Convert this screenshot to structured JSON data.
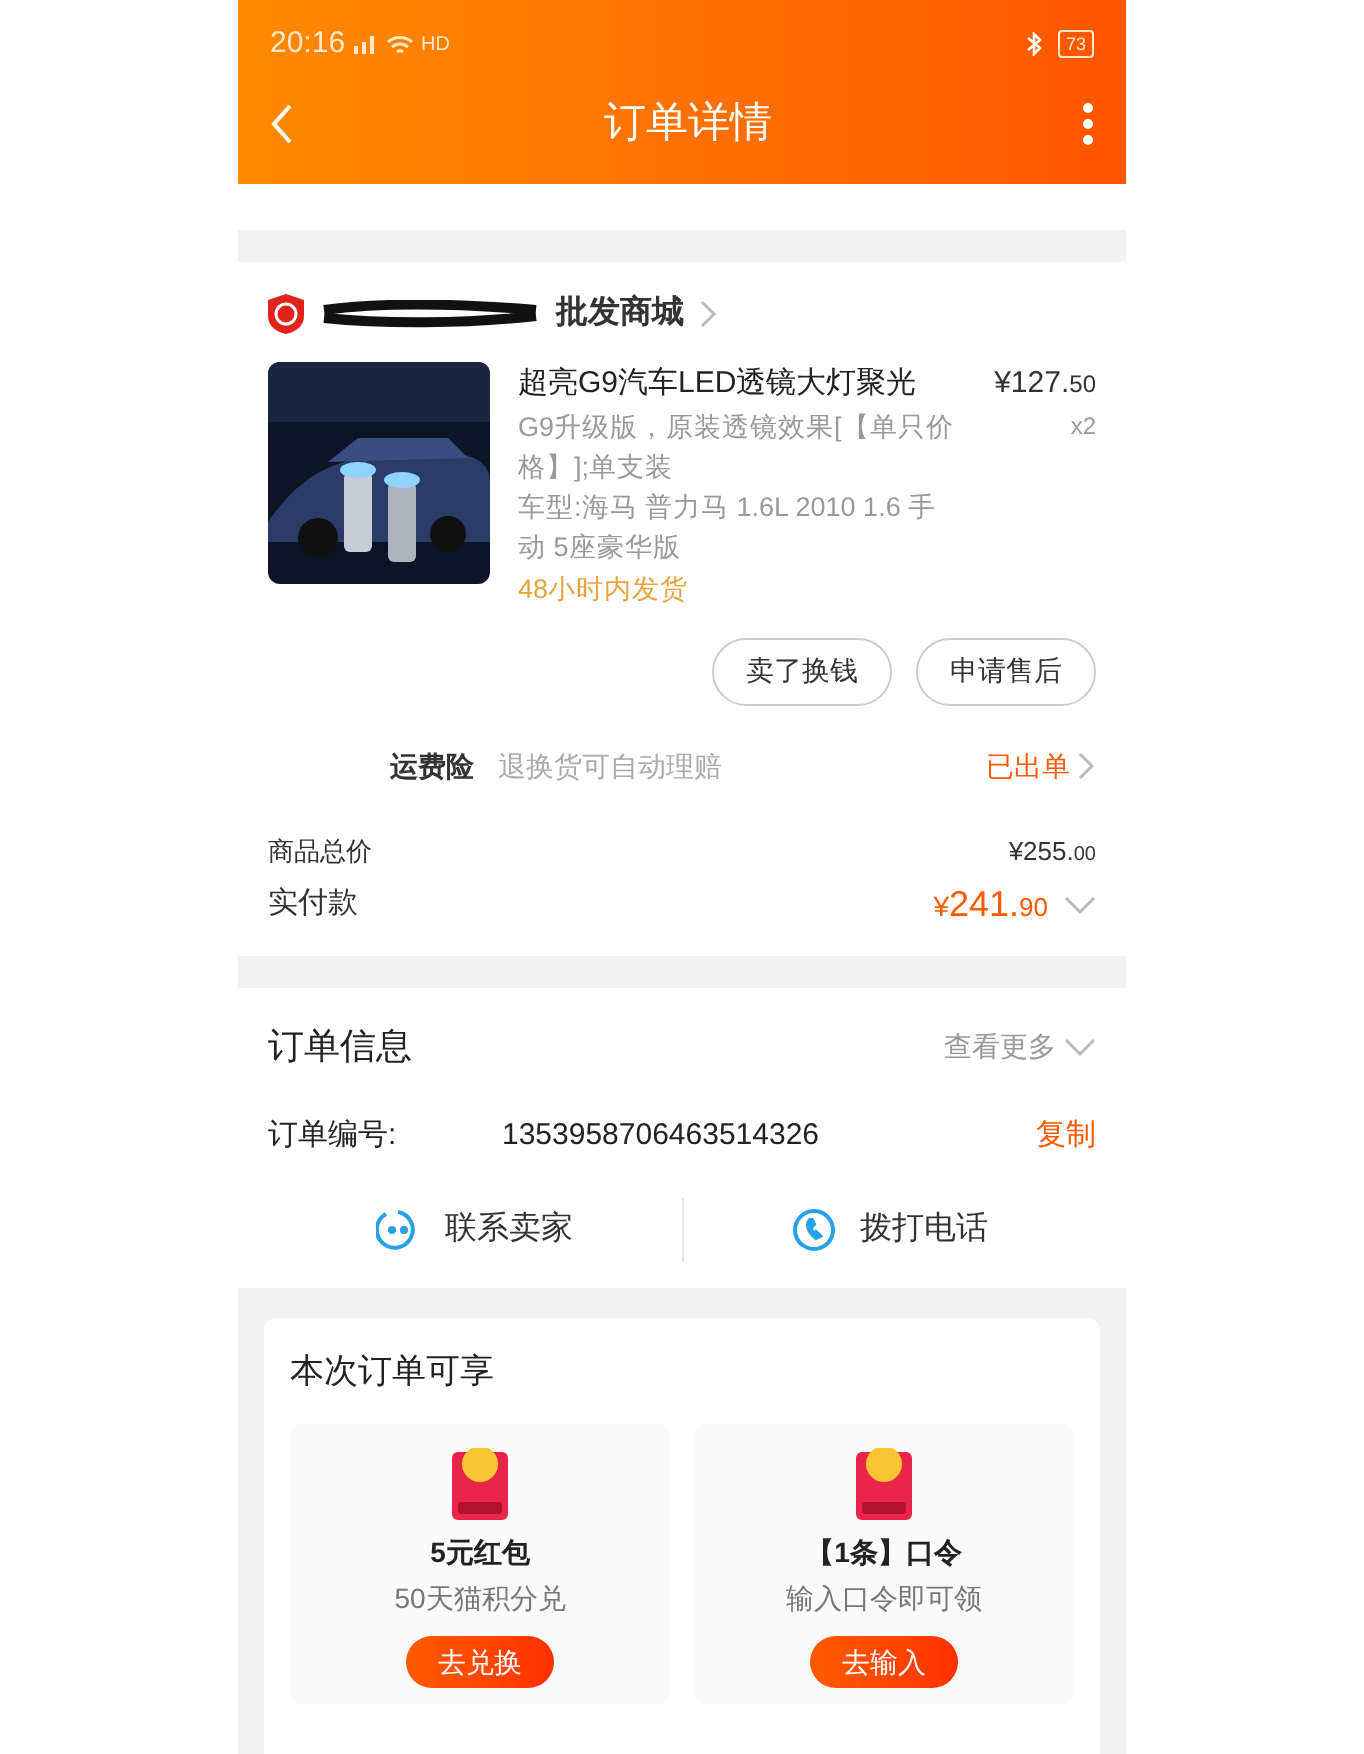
{
  "status_bar": {
    "time": "20:16",
    "network": "HD",
    "battery": "73"
  },
  "header": {
    "title": "订单详情"
  },
  "shop": {
    "name": "批发商城"
  },
  "product": {
    "title": "超亮G9汽车LED透镜大灯聚光",
    "price_main": "¥127.",
    "price_cents": "50",
    "quantity": "x2",
    "spec": "G9升级版，原装透镜效果[【单只价格】];单支装",
    "model": "车型:海马 普力马 1.6L 2010 1.6 手动 5座豪华版",
    "shipping": "48小时内发货"
  },
  "actions": [
    "卖了换钱",
    "申请售后"
  ],
  "insurance": {
    "label": "运费险",
    "desc": "退换货可自动理赔",
    "status": "已出单"
  },
  "totals": {
    "goods_label": "商品总价",
    "goods_main": "¥255.",
    "goods_cents": "00",
    "paid_label": "实付款",
    "paid_symbol": "¥",
    "paid_main": "241.",
    "paid_cents": "90"
  },
  "order_info": {
    "title": "订单信息",
    "more": "查看更多",
    "number_label": "订单编号:",
    "number": "1353958706463514326",
    "copy": "复制",
    "contact": "联系卖家",
    "call": "拨打电话"
  },
  "benefits": {
    "title": "本次订单可享",
    "items": [
      {
        "title": "5元红包",
        "desc": "50天猫积分兑",
        "button": "去兑换"
      },
      {
        "title": "【1条】口令",
        "desc": "输入口令即可领",
        "button": "去输入"
      }
    ]
  }
}
